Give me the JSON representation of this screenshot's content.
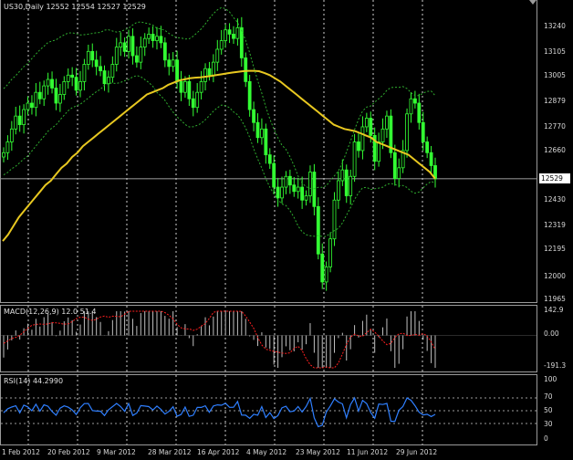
{
  "colors": {
    "background": "#000000",
    "grid": "#cfcfcf",
    "candle": "#33ff33",
    "ma": "#e8c820",
    "bands": "#2fae2f",
    "macd_hist": "#c0c0c0",
    "macd_signal": "#ff2020",
    "rsi_line": "#2f7fff",
    "text": "#d8d8d8"
  },
  "main": {
    "info": "US30,Daily  12552 12554 12527 12529",
    "price_tag": "12529",
    "price_axis": [
      "13240",
      "13105",
      "13005",
      "12879",
      "12770",
      "12660",
      "12529",
      "12430",
      "12319",
      "12195",
      "12000",
      "11965"
    ]
  },
  "macd": {
    "info": "MACD(12,26,9) 12.0 51.4",
    "axis": [
      "142.9",
      "0.00",
      "-191.3"
    ]
  },
  "rsi": {
    "info": "RSI(14) 44.2990",
    "axis": [
      "100",
      "70",
      "50",
      "30",
      "0"
    ]
  },
  "time_axis": [
    "1 Feb 2012",
    "20 Feb 2012",
    "9 Mar 2012",
    "28 Mar 2012",
    "16 Apr 2012",
    "4 May 2012",
    "23 May 2012",
    "11 Jun 2012",
    "29 Jun 2012"
  ],
  "chart_data": {
    "type": "candlestick",
    "symbol": "US30",
    "timeframe": "Daily",
    "last_ohlc": {
      "open": 12552,
      "high": 12554,
      "low": 12527,
      "close": 12529
    },
    "price_range": [
      11965,
      13240
    ],
    "close": [
      12650,
      12700,
      12760,
      12820,
      12780,
      12850,
      12880,
      12860,
      12930,
      12900,
      12960,
      12990,
      12950,
      12880,
      12920,
      12980,
      13010,
      13000,
      12940,
      12980,
      13060,
      13120,
      13080,
      13050,
      13030,
      12970,
      13000,
      13060,
      13140,
      13160,
      13120,
      13190,
      13100,
      13070,
      13140,
      13180,
      13200,
      13170,
      13190,
      13160,
      13080,
      13050,
      13080,
      12980,
      12930,
      12980,
      12900,
      12860,
      12930,
      12980,
      13040,
      13010,
      13070,
      13130,
      13170,
      13220,
      13200,
      13180,
      13230,
      13090,
      12980,
      12850,
      12790,
      12720,
      12760,
      12640,
      12600,
      12490,
      12440,
      12490,
      12540,
      12500,
      12470,
      12490,
      12430,
      12450,
      12560,
      12400,
      12180,
      12050,
      12120,
      12250,
      12430,
      12520,
      12570,
      12450,
      12540,
      12700,
      12660,
      12770,
      12810,
      12730,
      12610,
      12700,
      12760,
      12820,
      12650,
      12530,
      12580,
      12660,
      12830,
      12900,
      12880,
      12790,
      12700,
      12650,
      12590,
      12529
    ],
    "ma_line": [
      12240,
      12270,
      12310,
      12350,
      12380,
      12410,
      12440,
      12470,
      12500,
      12520,
      12550,
      12580,
      12600,
      12630,
      12650,
      12680,
      12700,
      12720,
      12740,
      12760,
      12780,
      12800,
      12820,
      12840,
      12860,
      12880,
      12900,
      12920,
      12930,
      12940,
      12950,
      12965,
      12975,
      12985,
      12990,
      12995,
      12998,
      13000,
      13003,
      13006,
      13010,
      13014,
      13018,
      13022,
      13025,
      13028,
      13030,
      13030,
      13028,
      13020,
      13010,
      12995,
      12980,
      12960,
      12940,
      12920,
      12900,
      12880,
      12860,
      12840,
      12820,
      12800,
      12780,
      12770,
      12760,
      12755,
      12750,
      12740,
      12730,
      12720,
      12700,
      12690,
      12680,
      12670,
      12660,
      12650,
      12640,
      12620,
      12600,
      12580,
      12560,
      12529
    ],
    "macd_axis": [
      -191.3,
      0.0,
      142.9
    ],
    "macd_value": 12.0,
    "macd_signal_value": 51.4,
    "rsi_period": 14,
    "rsi_value": 44.299,
    "rsi_levels": [
      70,
      50,
      30
    ]
  }
}
